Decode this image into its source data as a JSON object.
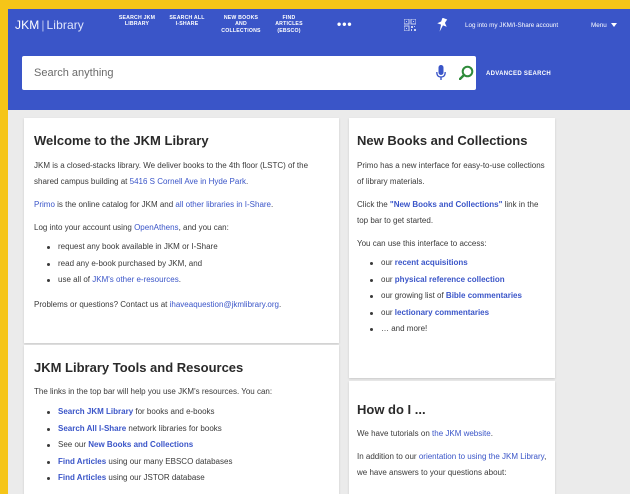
{
  "header": {
    "brand_name": "JKM",
    "brand_separator": "|",
    "brand_library": "Library",
    "nav": [
      {
        "label": "SEARCH JKM LIBRARY"
      },
      {
        "label": "SEARCH ALL I-SHARE"
      },
      {
        "label": "NEW BOOKS AND COLLECTIONS"
      },
      {
        "label": "FIND ARTICLES (EBSCO)"
      }
    ],
    "more": "•••",
    "login": "Log into my JKM/I-Share account",
    "menu": "Menu"
  },
  "search": {
    "placeholder": "Search anything",
    "advanced": "ADVANCED SEARCH"
  },
  "welcome": {
    "title": "Welcome to the JKM Library",
    "p1_text": "JKM is a closed-stacks library. We deliver books to the 4th floor (LSTC) of the shared campus building at ",
    "p1_link": "5416 S Cornell Ave in Hyde Park",
    "p1_end": ".",
    "p2_link1": "Primo",
    "p2_text": " is the online catalog for JKM and ",
    "p2_link2": "all other libraries in I-Share",
    "p2_end": ".",
    "p3_text": "Log into your account using ",
    "p3_link": "OpenAthens",
    "p3_end": ", and you can:",
    "list": [
      {
        "text": "request any book available in JKM or I-Share"
      },
      {
        "text": "read any e-book purchased by JKM, and"
      },
      {
        "pre": "use all of ",
        "link": "JKM's other e-resources",
        "post": "."
      }
    ],
    "p4_text": "Problems or questions? Contact us at ",
    "p4_link": "ihaveaquestion@jkmlibrary.org",
    "p4_end": "."
  },
  "tools": {
    "title": "JKM Library Tools and Resources",
    "intro": "The links in the top bar will help you use JKM's resources. You can:",
    "list": [
      {
        "pre": "",
        "link": "Search JKM Library",
        "post": " for books and e-books"
      },
      {
        "pre": "",
        "link": "Search All I-Share",
        "post": " network libraries for books"
      },
      {
        "pre": "See our ",
        "link": "New Books and Collections",
        "post": ""
      },
      {
        "pre": "",
        "link": "Find Articles",
        "post": " using our many EBSCO databases"
      },
      {
        "pre": "",
        "link": "Find Articles",
        "post": " using our JSTOR database"
      }
    ]
  },
  "newbooks": {
    "title": "New Books and Collections",
    "p1": "Primo has a new interface for easy-to-use collections of library materials.",
    "p2_pre": "Click the ",
    "p2_link": "\"New Books and Collections\"",
    "p2_post": " link in the top bar to get started.",
    "p3": "You can use this interface to access:",
    "list": [
      {
        "pre": "our ",
        "link": "recent acquisitions",
        "post": ""
      },
      {
        "pre": "our ",
        "link": "physical reference collection",
        "post": ""
      },
      {
        "pre": "our growing list of ",
        "link": "Bible commentaries",
        "post": ""
      },
      {
        "pre": "our ",
        "link": "lectionary commentaries",
        "post": ""
      },
      {
        "pre": "… and more!",
        "link": "",
        "post": ""
      }
    ]
  },
  "howdo": {
    "title": "How do I ...",
    "p1_pre": "We have tutorials on ",
    "p1_link": "the JKM website",
    "p1_post": ".",
    "p2_pre": "In addition to our ",
    "p2_link": "orientation to using the JKM Library",
    "p2_post": ", we have answers to your questions about:"
  },
  "colors": {
    "accent": "#3a55c8",
    "frame": "#f5c518",
    "background": "#ebebeb",
    "search_green": "#2e8b3a"
  }
}
